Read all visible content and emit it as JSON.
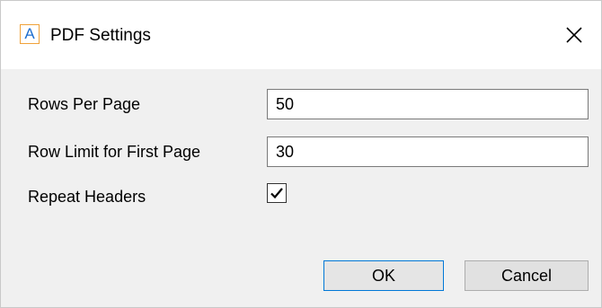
{
  "window": {
    "title": "PDF Settings",
    "app_icon_letter": "A",
    "close_icon": "close-icon",
    "accent_color": "#0078d7",
    "icon_border_color": "#f0a23a",
    "icon_letter_color": "#1f6fd0"
  },
  "form": {
    "rows_per_page": {
      "label": "Rows Per Page",
      "value": "50"
    },
    "row_limit_first_page": {
      "label": "Row Limit for First Page",
      "value": "30"
    },
    "repeat_headers": {
      "label": "Repeat Headers",
      "checked": true,
      "icon": "checkmark-icon"
    }
  },
  "buttons": {
    "ok_label": "OK",
    "cancel_label": "Cancel"
  }
}
